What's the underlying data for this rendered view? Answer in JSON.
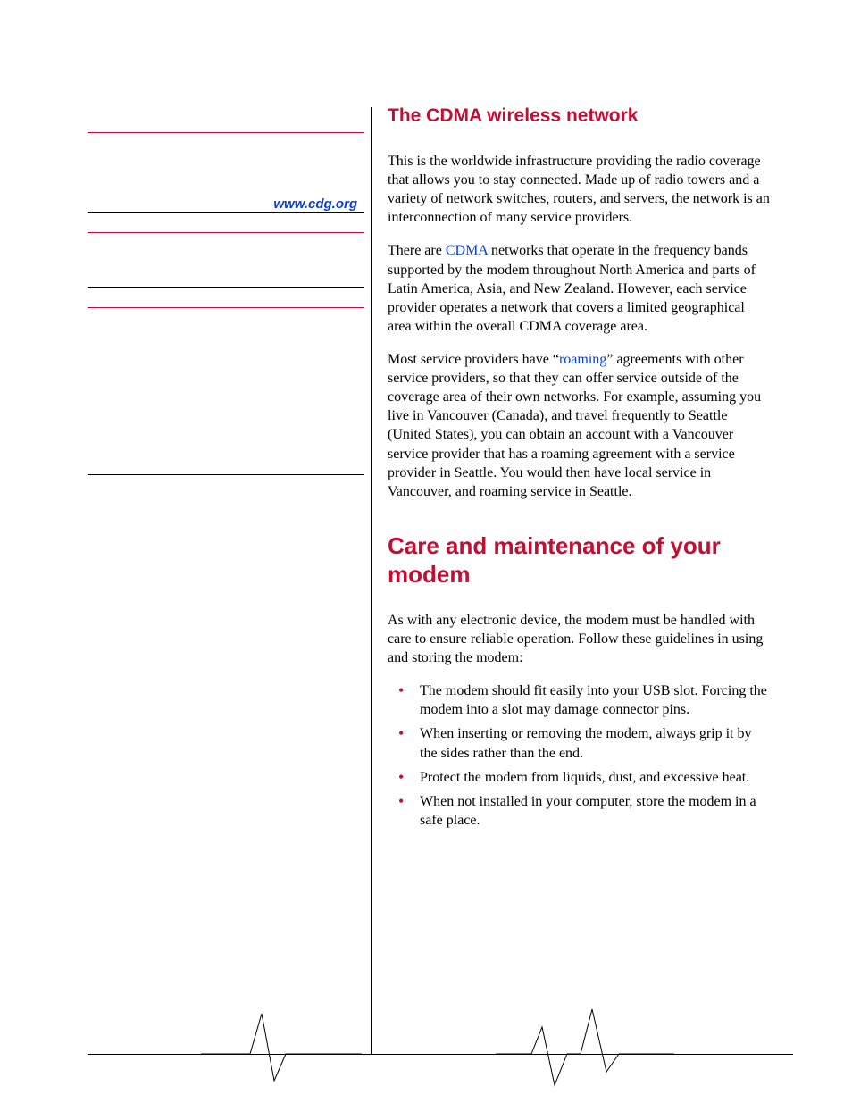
{
  "sidebar": {
    "link": "www.cdg.org"
  },
  "section1": {
    "heading": "The CDMA wireless network",
    "p1": "This is the worldwide infrastructure providing the radio coverage that allows you to stay connected. Made up of radio towers and a variety of network switches, routers, and servers, the network is an interconnection of many service providers.",
    "p2a": "There are ",
    "p2_link": "CDMA",
    "p2b": " networks that operate in the frequency bands supported by the modem throughout North America and parts of Latin America, Asia, and New Zealand. However, each service provider operates a network that covers a limited geographical area within the overall CDMA coverage area.",
    "p3a": "Most service providers have “",
    "p3_link": "roaming",
    "p3b": "” agreements with other service providers, so that they can offer service outside of the coverage area of their own networks. For example, assuming you live in Vancouver (Canada), and travel frequently to Seattle (United States), you can obtain an account with a Vancouver service provider that has a roaming agreement with a service provider in Seattle. You would then have local service in Vancouver, and roaming service in Seattle."
  },
  "section2": {
    "heading": "Care and maintenance of your modem",
    "p1": "As with any electronic device, the modem must be handled with care to ensure reliable operation. Follow these guidelines in using and storing the modem:",
    "bullets": [
      "The modem should fit easily into your USB slot. Forcing the modem into a slot may damage connector pins.",
      "When inserting or removing the modem, always grip it by the sides rather than the end.",
      "Protect the modem from liquids, dust, and excessive heat.",
      "When not installed in your computer, store the modem in a safe place."
    ]
  }
}
